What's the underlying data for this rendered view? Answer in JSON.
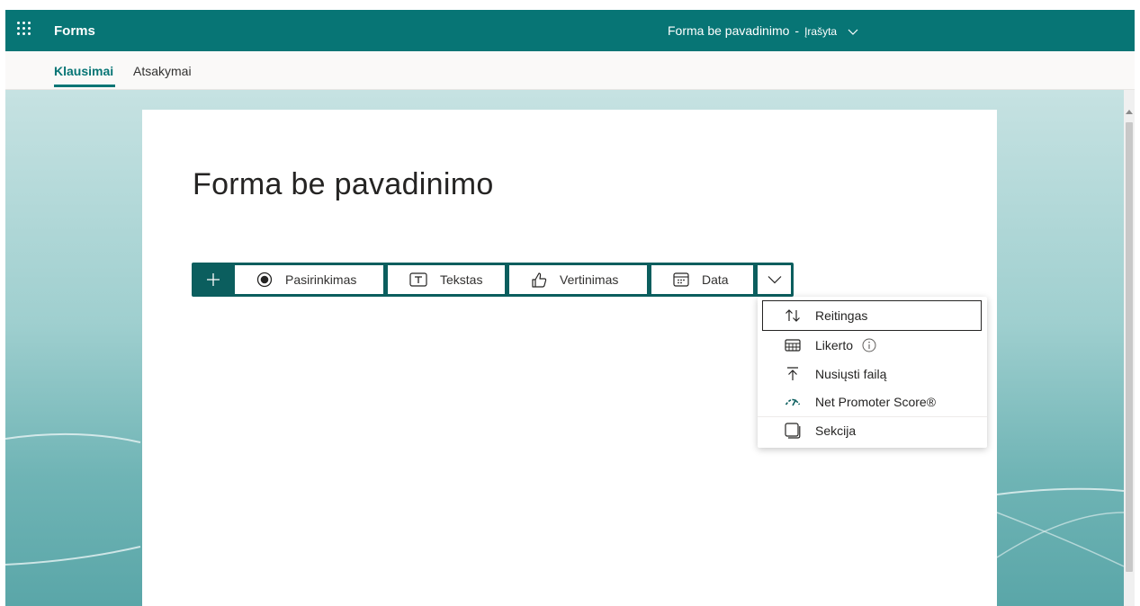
{
  "header": {
    "app_name": "Forms",
    "doc_title": "Forma be pavadinimo",
    "separator": "-",
    "save_status": "Įrašyta"
  },
  "tabs": [
    {
      "label": "Klausimai",
      "active": true
    },
    {
      "label": "Atsakymai",
      "active": false
    }
  ],
  "form": {
    "title": "Forma be pavadinimo"
  },
  "question_types": [
    {
      "label": "Pasirinkimas",
      "icon": "radio-icon"
    },
    {
      "label": "Tekstas",
      "icon": "text-box-icon"
    },
    {
      "label": "Vertinimas",
      "icon": "thumb-up-icon"
    },
    {
      "label": "Data",
      "icon": "calendar-icon"
    }
  ],
  "more_menu": [
    {
      "label": "Reitingas",
      "icon": "sort-arrows-icon"
    },
    {
      "label": "Likerto",
      "icon": "grid-icon"
    },
    {
      "label": "Nusiųsti failą",
      "icon": "upload-icon"
    },
    {
      "label": "Net Promoter Score®",
      "icon": "gauge-icon"
    },
    {
      "label": "Sekcija",
      "icon": "section-icon"
    }
  ],
  "colors": {
    "brand": "#077575",
    "toolbar": "#0b5e5e"
  }
}
